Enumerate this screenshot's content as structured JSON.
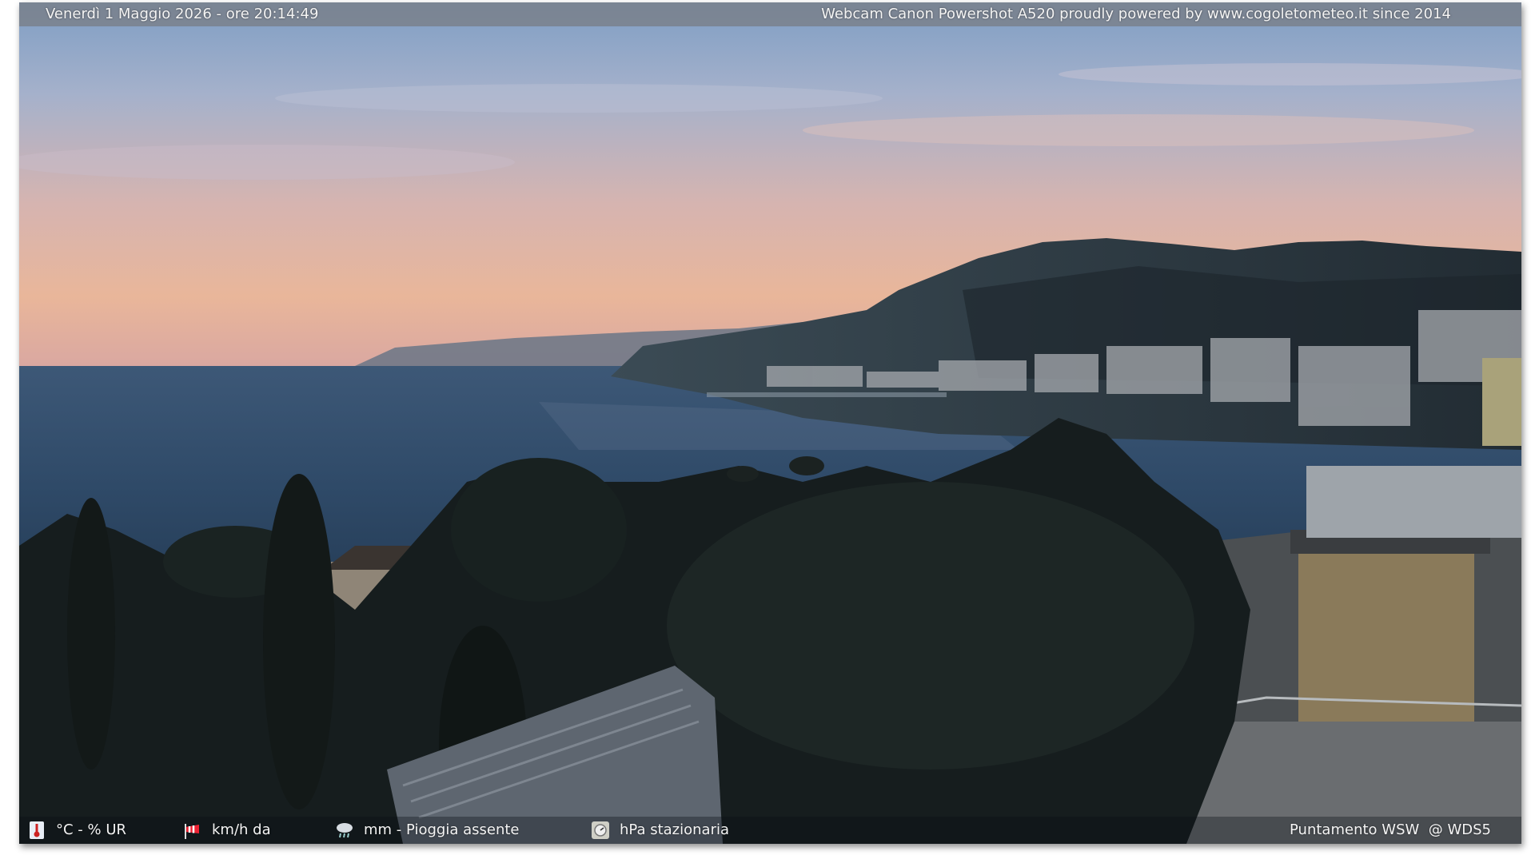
{
  "header": {
    "datetime": "Venerdì 1 Maggio 2026 - ore 20:14:49",
    "credit": "Webcam Canon Powershot A520 proudly powered by www.cogoletometeo.it since 2014"
  },
  "footer": {
    "temperature": {
      "icon": "thermometer-icon",
      "text": "°C - % UR"
    },
    "wind": {
      "icon": "windsock-icon",
      "text": "km/h da"
    },
    "rain": {
      "icon": "rain-cloud-icon",
      "text": "mm - Pioggia assente"
    },
    "pressure": {
      "icon": "barometer-icon",
      "text": "hPa stazionaria"
    },
    "pointing": "Puntamento WSW  @ WDS5"
  },
  "colors": {
    "sky_top": "#7f9ec4",
    "sky_horizon": "#e9b69a",
    "sea": "#35506f",
    "hills": "#26323c",
    "vegetation": "#151c1c"
  }
}
